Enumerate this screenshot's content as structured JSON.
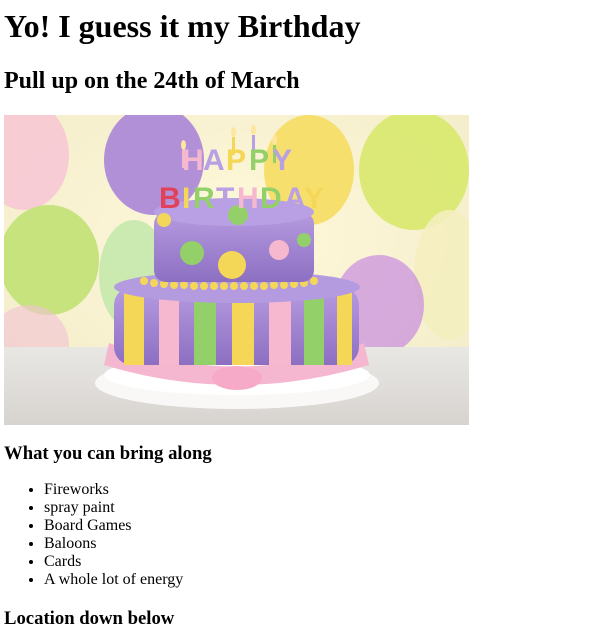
{
  "page": {
    "heading": "Yo! I guess it my Birthday",
    "subheading": "Pull up on the 24th of March",
    "image": {
      "cake_topper_text": "HAPPY BIRTHDAY",
      "colors": {
        "bg": "#f6f2d6",
        "purple": "#a184cf",
        "yellow": "#f4d757",
        "green": "#93d06a",
        "pink": "#f5b8cf",
        "white": "#f5f3f1"
      }
    },
    "bring_heading": "What you can bring along",
    "bring_items": [
      "Fireworks",
      "spray paint",
      "Board Games",
      "Baloons",
      "Cards",
      "A whole lot of energy"
    ],
    "location_heading": "Location down below"
  }
}
